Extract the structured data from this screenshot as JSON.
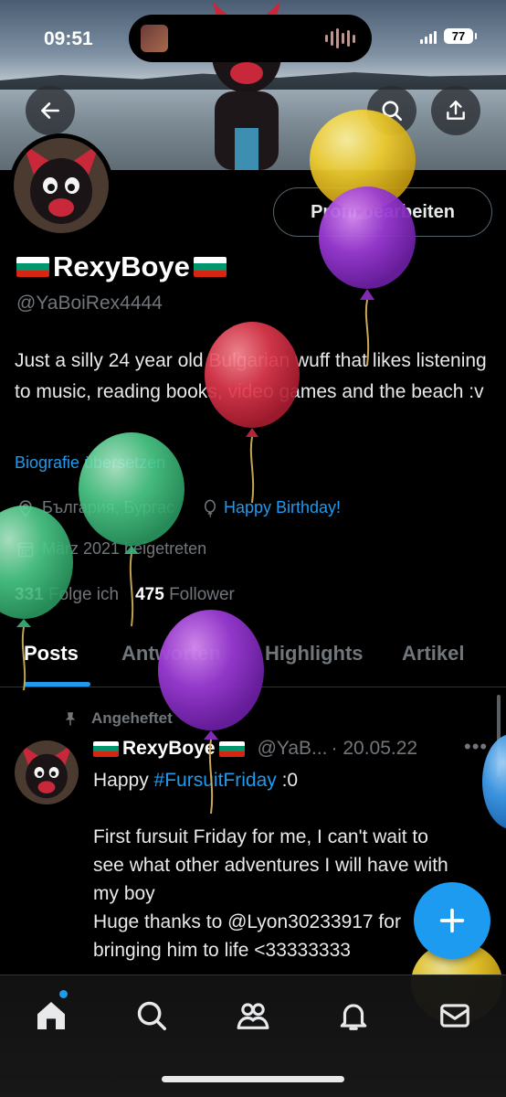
{
  "status_bar": {
    "time": "09:51",
    "battery": "77"
  },
  "header": {
    "back_icon": "arrow-left-icon",
    "search_icon": "search-icon",
    "share_icon": "share-upload-icon"
  },
  "profile": {
    "edit_button": "Profil bearbeiten",
    "display_name": "RexyBoye",
    "handle": "@YaBoiRex4444",
    "bio": "Just a silly 24 year old Bulgarian wuff that likes listening to music, reading books, video games and the beach :v",
    "translate_link": "Biografie übersetzen",
    "location": "България, Бургас",
    "birthday": "Happy Birthday!",
    "joined": "März 2021 beigetreten",
    "following_count": "331",
    "following_label": "Folge ich",
    "followers_count": "475",
    "followers_label": "Follower"
  },
  "tabs": [
    {
      "label": "Posts",
      "active": true
    },
    {
      "label": "Antworten",
      "active": false
    },
    {
      "label": "Highlights",
      "active": false
    },
    {
      "label": "Artikel",
      "active": false
    }
  ],
  "post": {
    "pinned_label": "Angeheftet",
    "name": "RexyBoye",
    "handle": "@YaB...",
    "date": "· 20.05.22",
    "more": "•••",
    "text_before_tag": "Happy ",
    "hashtag": "#FursuitFriday",
    "text_after_tag": " :0\n\nFirst fursuit Friday for me, I can't wait to see what other adventures I will have with my boy\nHuge thanks to @Lyon30233917 for bringing him to life <33333333"
  },
  "colors": {
    "accent": "#1d9bf0",
    "flag_white": "#ffffff",
    "flag_green": "#00966e",
    "flag_red": "#d62612"
  },
  "bottom_nav": [
    {
      "name": "home-icon",
      "active": true,
      "badge": true
    },
    {
      "name": "search-icon",
      "active": false
    },
    {
      "name": "communities-icon",
      "active": false
    },
    {
      "name": "notifications-bell-icon",
      "active": false
    },
    {
      "name": "messages-mail-icon",
      "active": false
    }
  ],
  "fab_icon": "plus-icon"
}
